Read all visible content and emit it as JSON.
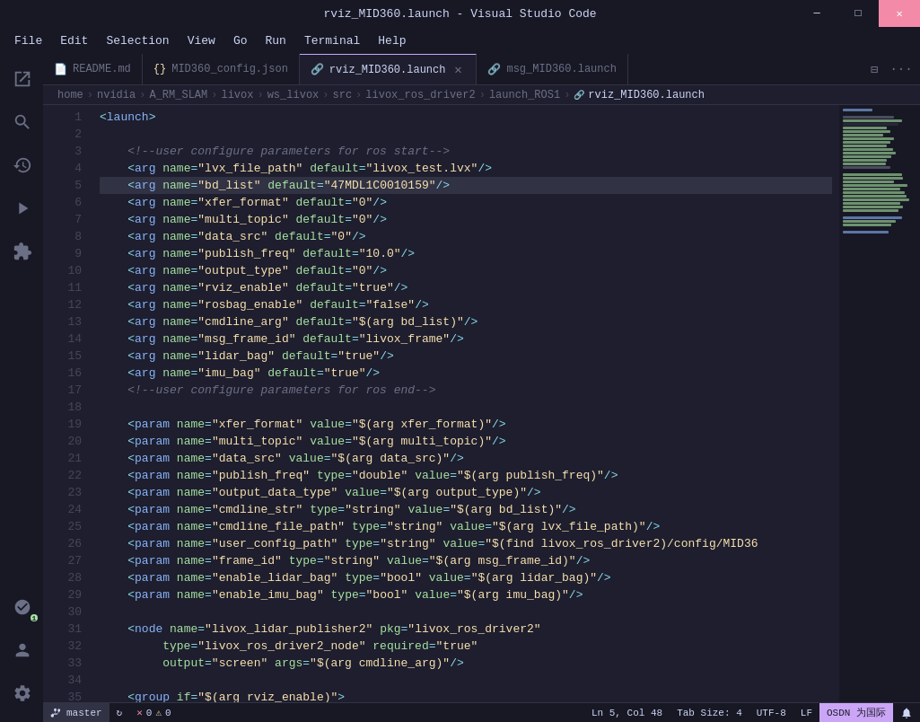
{
  "window": {
    "title": "rviz_MID360.launch - Visual Studio Code",
    "controls": {
      "minimize": "—",
      "maximize": "□",
      "close": "✕"
    }
  },
  "menu": {
    "items": [
      "File",
      "Edit",
      "Selection",
      "View",
      "Go",
      "Run",
      "Terminal",
      "Help"
    ]
  },
  "activity_bar": {
    "icons": [
      {
        "name": "explorer",
        "symbol": "⊞",
        "active": false
      },
      {
        "name": "search",
        "symbol": "🔍",
        "active": false
      },
      {
        "name": "source-control",
        "symbol": "⌥",
        "active": false
      },
      {
        "name": "run-debug",
        "symbol": "▷",
        "active": false
      },
      {
        "name": "extensions",
        "symbol": "⊟",
        "active": false
      }
    ],
    "bottom": [
      {
        "name": "remote",
        "symbol": "⊞"
      },
      {
        "name": "account",
        "symbol": "◯"
      },
      {
        "name": "settings",
        "symbol": "⚙"
      }
    ]
  },
  "tabs": [
    {
      "label": "README.md",
      "icon": "md",
      "active": false,
      "closable": false
    },
    {
      "label": "MID360_config.json",
      "icon": "json",
      "active": false,
      "closable": false
    },
    {
      "label": "rviz_MID360.launch",
      "icon": "launch",
      "active": true,
      "closable": true
    },
    {
      "label": "msg_MID360.launch",
      "icon": "launch",
      "active": false,
      "closable": false
    }
  ],
  "breadcrumb": {
    "parts": [
      "home",
      "nvidia",
      "A_RM_SLAM",
      "livox",
      "ws_livox",
      "src",
      "livox_ros_driver2",
      "launch_ROS1",
      "rviz_MID360.launch"
    ]
  },
  "code": {
    "lines": [
      {
        "num": 1,
        "content": "<launch>",
        "highlight": false
      },
      {
        "num": 2,
        "content": "",
        "highlight": false
      },
      {
        "num": 3,
        "content": "    <!--user configure parameters for ros start-->",
        "highlight": false
      },
      {
        "num": 4,
        "content": "    <arg name=\"lvx_file_path\" default=\"livox_test.lvx\"/>",
        "highlight": false
      },
      {
        "num": 5,
        "content": "    <arg name=\"bd_list\" default=\"47MDL1C0010159\"/>",
        "highlight": true
      },
      {
        "num": 6,
        "content": "    <arg name=\"xfer_format\" default=\"0\"/>",
        "highlight": false
      },
      {
        "num": 7,
        "content": "    <arg name=\"multi_topic\" default=\"0\"/>",
        "highlight": false
      },
      {
        "num": 8,
        "content": "    <arg name=\"data_src\" default=\"0\"/>",
        "highlight": false
      },
      {
        "num": 9,
        "content": "    <arg name=\"publish_freq\" default=\"10.0\"/>",
        "highlight": false
      },
      {
        "num": 10,
        "content": "    <arg name=\"output_type\" default=\"0\"/>",
        "highlight": false
      },
      {
        "num": 11,
        "content": "    <arg name=\"rviz_enable\" default=\"true\"/>",
        "highlight": false
      },
      {
        "num": 12,
        "content": "    <arg name=\"rosbag_enable\" default=\"false\"/>",
        "highlight": false
      },
      {
        "num": 13,
        "content": "    <arg name=\"cmdline_arg\" default=\"$(arg bd_list)\"/>",
        "highlight": false
      },
      {
        "num": 14,
        "content": "    <arg name=\"msg_frame_id\" default=\"livox_frame\"/>",
        "highlight": false
      },
      {
        "num": 15,
        "content": "    <arg name=\"lidar_bag\" default=\"true\"/>",
        "highlight": false
      },
      {
        "num": 16,
        "content": "    <arg name=\"imu_bag\" default=\"true\"/>",
        "highlight": false
      },
      {
        "num": 17,
        "content": "    <!--user configure parameters for ros end-->",
        "highlight": false
      },
      {
        "num": 18,
        "content": "",
        "highlight": false
      },
      {
        "num": 19,
        "content": "    <param name=\"xfer_format\" value=\"$(arg xfer_format)\"/>",
        "highlight": false
      },
      {
        "num": 20,
        "content": "    <param name=\"multi_topic\" value=\"$(arg multi_topic)\"/>",
        "highlight": false
      },
      {
        "num": 21,
        "content": "    <param name=\"data_src\" value=\"$(arg data_src)\"/>",
        "highlight": false
      },
      {
        "num": 22,
        "content": "    <param name=\"publish_freq\" type=\"double\" value=\"$(arg publish_freq)\"/>",
        "highlight": false
      },
      {
        "num": 23,
        "content": "    <param name=\"output_data_type\" value=\"$(arg output_type)\"/>",
        "highlight": false
      },
      {
        "num": 24,
        "content": "    <param name=\"cmdline_str\" type=\"string\" value=\"$(arg bd_list)\"/>",
        "highlight": false
      },
      {
        "num": 25,
        "content": "    <param name=\"cmdline_file_path\" type=\"string\" value=\"$(arg lvx_file_path)\"/>",
        "highlight": false
      },
      {
        "num": 26,
        "content": "    <param name=\"user_config_path\" type=\"string\" value=\"$(find livox_ros_driver2)/config/MID36",
        "highlight": false
      },
      {
        "num": 27,
        "content": "    <param name=\"frame_id\" type=\"string\" value=\"$(arg msg_frame_id)\"/>",
        "highlight": false
      },
      {
        "num": 28,
        "content": "    <param name=\"enable_lidar_bag\" type=\"bool\" value=\"$(arg lidar_bag)\"/>",
        "highlight": false
      },
      {
        "num": 29,
        "content": "    <param name=\"enable_imu_bag\" type=\"bool\" value=\"$(arg imu_bag)\"/>",
        "highlight": false
      },
      {
        "num": 30,
        "content": "",
        "highlight": false
      },
      {
        "num": 31,
        "content": "    <node name=\"livox_lidar_publisher2\" pkg=\"livox_ros_driver2\"",
        "highlight": false
      },
      {
        "num": 32,
        "content": "         type=\"livox_ros_driver2_node\" required=\"true\"",
        "highlight": false
      },
      {
        "num": 33,
        "content": "         output=\"screen\" args=\"$(arg cmdline_arg)\"/>",
        "highlight": false
      },
      {
        "num": 34,
        "content": "",
        "highlight": false
      },
      {
        "num": 35,
        "content": "    <group if=\"$(arg rviz_enable)\">",
        "highlight": false
      }
    ]
  },
  "status_bar": {
    "branch": "master",
    "sync_icon": "↻",
    "errors": "0",
    "warnings": "0",
    "position": "Ln 5, Col 48",
    "tab_size": "Tab Size: 4",
    "encoding": "UTF-8",
    "line_ending": "LF",
    "language": "OSDN 为国际",
    "remote": "⊞"
  }
}
